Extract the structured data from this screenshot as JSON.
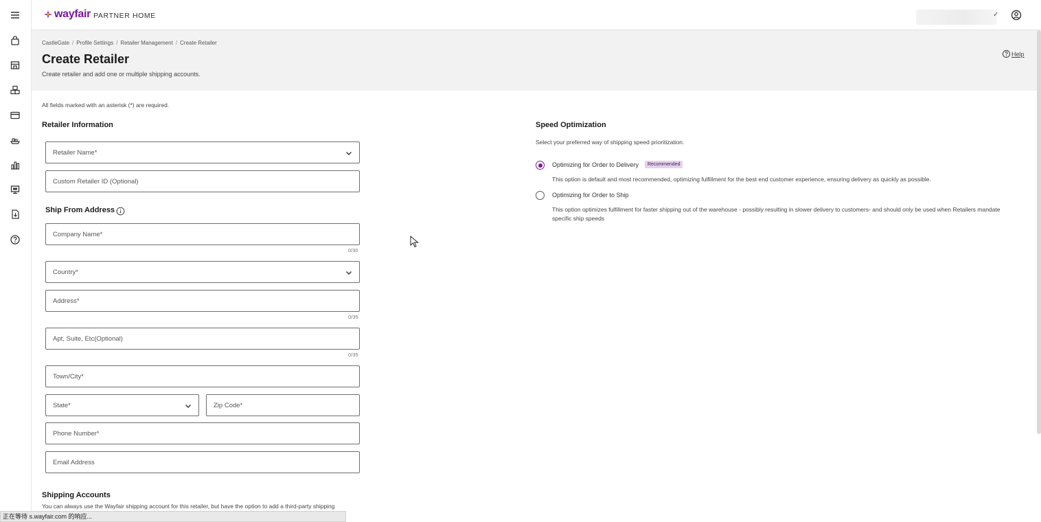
{
  "brand": {
    "logo_text": "wayfair",
    "logo_sub": "PARTNER HOME",
    "accent_color": "#7b189f"
  },
  "sidebar": {
    "items": [
      {
        "name": "menu-icon"
      },
      {
        "name": "bag-icon"
      },
      {
        "name": "store-icon"
      },
      {
        "name": "boxes-icon"
      },
      {
        "name": "card-icon"
      },
      {
        "name": "ship-icon"
      },
      {
        "name": "bar-chart-icon"
      },
      {
        "name": "monitor-icon"
      },
      {
        "name": "download-doc-icon"
      },
      {
        "name": "help-circle-icon"
      }
    ]
  },
  "header": {
    "breadcrumbs": [
      "CastleGate",
      "Profile Settings",
      "Retailer Management",
      "Create Retailer"
    ],
    "title": "Create Retailer",
    "subtitle": "Create retailer and add one or multiple shipping accounts.",
    "help_label": "Help"
  },
  "form": {
    "required_note": "All fields marked with an asterisk (*) are required.",
    "retailer_section_title": "Retailer Information",
    "retailer_name": "Retailer Name*",
    "custom_retailer_id": "Custom Retailer ID (Optional)",
    "ship_from_title": "Ship From Address",
    "company_name": "Company Name*",
    "company_counter": "0/30",
    "country": "Country*",
    "address": "Address*",
    "address_counter": "0/35",
    "apt": "Apt, Suite, Etc(Optional)",
    "apt_counter": "0/35",
    "town": "Town/City*",
    "state": "State*",
    "zip": "Zip Code*",
    "phone": "Phone Number*",
    "email": "Email Address",
    "shipping_accounts_title": "Shipping Accounts",
    "shipping_accounts_desc": "You can always use the Wayfair shipping account for this retailer, but have the option to add a third-party shipping"
  },
  "speed": {
    "title": "Speed Optimization",
    "desc": "Select your preferred way of shipping speed prioritization.",
    "option1_label": "Optimizing for Order to Delivery",
    "option1_badge": "Recommended",
    "option1_desc": "This option is default and most recommended, optimizing fulfillment for the best end customer experience, ensuring delivery as quickly as possible.",
    "option2_label": "Optimizing for Order to Ship",
    "option2_desc": "This option optimizes fulfillment for faster shipping out of the warehouse - possibly resulting in slower delivery to customers- and should only be used when Retailers mandate specific ship speeds",
    "selected": "option1"
  },
  "statusbar": {
    "text": "正在等待 s.wayfair.com 的响应..."
  }
}
